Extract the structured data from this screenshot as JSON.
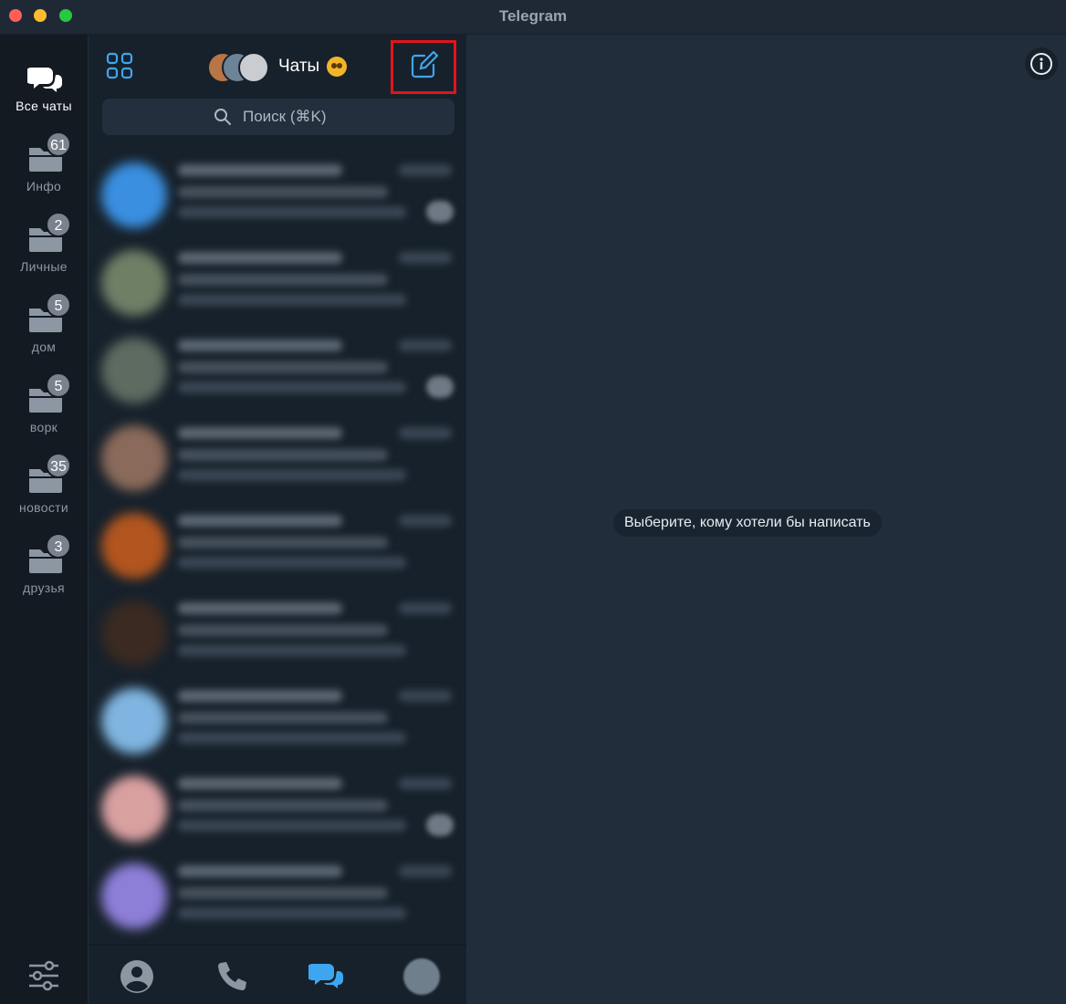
{
  "window": {
    "title": "Telegram"
  },
  "folders": [
    {
      "label": "Все чаты",
      "badge": null
    },
    {
      "label": "Инфо",
      "badge": "61"
    },
    {
      "label": "Личные",
      "badge": "2"
    },
    {
      "label": "дом",
      "badge": "5"
    },
    {
      "label": "ворк",
      "badge": "5"
    },
    {
      "label": "новости",
      "badge": "35"
    },
    {
      "label": "друзья",
      "badge": "3"
    }
  ],
  "header": {
    "title": "Чаты"
  },
  "search": {
    "placeholder": "Поиск (⌘K)"
  },
  "chats": [
    {
      "avatar_color": "#3a8fe0",
      "unread": true
    },
    {
      "avatar_color": "#6f7f66",
      "unread": false
    },
    {
      "avatar_color": "#5d6b61",
      "unread": true
    },
    {
      "avatar_color": "#8a6a5a",
      "unread": false
    },
    {
      "avatar_color": "#b2551f",
      "unread": false
    },
    {
      "avatar_color": "#3a2a22",
      "unread": false
    },
    {
      "avatar_color": "#7fb5e0",
      "unread": false
    },
    {
      "avatar_color": "#d9a0a0",
      "unread": true
    },
    {
      "avatar_color": "#8d7ed8",
      "unread": false
    }
  ],
  "main": {
    "empty_text": "Выберите, кому хотели бы написать"
  },
  "icons": {
    "accent": "#3ea6f0",
    "muted": "#8c97a3"
  }
}
